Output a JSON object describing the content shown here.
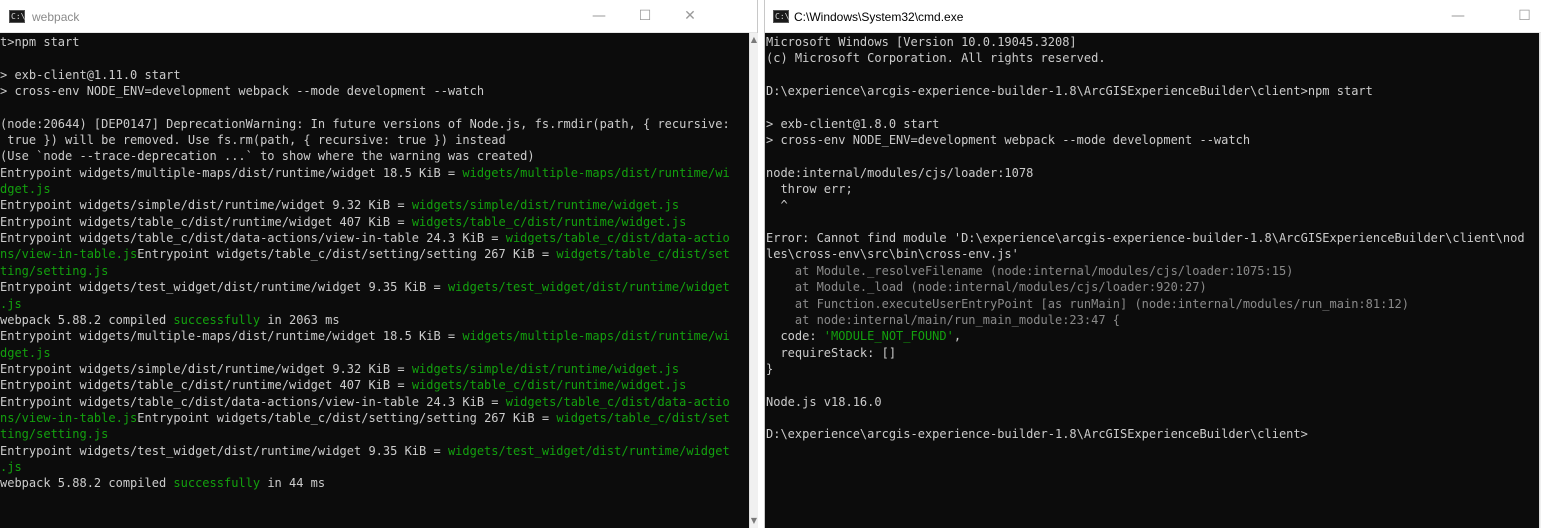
{
  "windows": [
    {
      "title": "webpack",
      "lines": [
        [
          {
            "t": "t>npm start"
          }
        ],
        [
          {
            "t": ""
          }
        ],
        [
          {
            "t": "> exb-client@1.11.0 start"
          }
        ],
        [
          {
            "t": "> cross-env NODE_ENV=development webpack --mode development --watch"
          }
        ],
        [
          {
            "t": ""
          }
        ],
        [
          {
            "t": "(node:20644) [DEP0147] DeprecationWarning: In future versions of Node.js, fs.rmdir(path, { recursive:"
          }
        ],
        [
          {
            "t": " true }) will be removed. Use fs.rm(path, { recursive: true }) instead"
          }
        ],
        [
          {
            "t": "(Use `node --trace-deprecation ...` to show where the warning was created)"
          }
        ],
        [
          {
            "t": "Entrypoint widgets/multiple-maps/dist/runtime/widget 18.5 KiB = "
          },
          {
            "t": "widgets/multiple-maps/dist/runtime/wi",
            "c": "g"
          }
        ],
        [
          {
            "t": "dget.js",
            "c": "g"
          }
        ],
        [
          {
            "t": "Entrypoint widgets/simple/dist/runtime/widget 9.32 KiB = "
          },
          {
            "t": "widgets/simple/dist/runtime/widget.js",
            "c": "g"
          }
        ],
        [
          {
            "t": "Entrypoint widgets/table_c/dist/runtime/widget 407 KiB = "
          },
          {
            "t": "widgets/table_c/dist/runtime/widget.js",
            "c": "g"
          }
        ],
        [
          {
            "t": "Entrypoint widgets/table_c/dist/data-actions/view-in-table 24.3 KiB = "
          },
          {
            "t": "widgets/table_c/dist/data-actio",
            "c": "g"
          }
        ],
        [
          {
            "t": "ns/view-in-table.js",
            "c": "g"
          },
          {
            "t": "Entrypoint widgets/table_c/dist/setting/setting 267 KiB = "
          },
          {
            "t": "widgets/table_c/dist/set",
            "c": "g"
          }
        ],
        [
          {
            "t": "ting/setting.js",
            "c": "g"
          }
        ],
        [
          {
            "t": "Entrypoint widgets/test_widget/dist/runtime/widget 9.35 KiB = "
          },
          {
            "t": "widgets/test_widget/dist/runtime/widget",
            "c": "g"
          }
        ],
        [
          {
            "t": ".js",
            "c": "g"
          }
        ],
        [
          {
            "t": "webpack 5.88.2 compiled "
          },
          {
            "t": "successfully",
            "c": "g"
          },
          {
            "t": " in 2063 ms"
          }
        ],
        [
          {
            "t": "Entrypoint widgets/multiple-maps/dist/runtime/widget 18.5 KiB = "
          },
          {
            "t": "widgets/multiple-maps/dist/runtime/wi",
            "c": "g"
          }
        ],
        [
          {
            "t": "dget.js",
            "c": "g"
          }
        ],
        [
          {
            "t": "Entrypoint widgets/simple/dist/runtime/widget 9.32 KiB = "
          },
          {
            "t": "widgets/simple/dist/runtime/widget.js",
            "c": "g"
          }
        ],
        [
          {
            "t": "Entrypoint widgets/table_c/dist/runtime/widget 407 KiB = "
          },
          {
            "t": "widgets/table_c/dist/runtime/widget.js",
            "c": "g"
          }
        ],
        [
          {
            "t": "Entrypoint widgets/table_c/dist/data-actions/view-in-table 24.3 KiB = "
          },
          {
            "t": "widgets/table_c/dist/data-actio",
            "c": "g"
          }
        ],
        [
          {
            "t": "ns/view-in-table.js",
            "c": "g"
          },
          {
            "t": "Entrypoint widgets/table_c/dist/setting/setting 267 KiB = "
          },
          {
            "t": "widgets/table_c/dist/set",
            "c": "g"
          }
        ],
        [
          {
            "t": "ting/setting.js",
            "c": "g"
          }
        ],
        [
          {
            "t": "Entrypoint widgets/test_widget/dist/runtime/widget 9.35 KiB = "
          },
          {
            "t": "widgets/test_widget/dist/runtime/widget",
            "c": "g"
          }
        ],
        [
          {
            "t": ".js",
            "c": "g"
          }
        ],
        [
          {
            "t": "webpack 5.88.2 compiled "
          },
          {
            "t": "successfully",
            "c": "g"
          },
          {
            "t": " in 44 ms"
          }
        ]
      ]
    },
    {
      "title": "C:\\Windows\\System32\\cmd.exe",
      "lines": [
        [
          {
            "t": "Microsoft Windows [Version 10.0.19045.3208]"
          }
        ],
        [
          {
            "t": "(c) Microsoft Corporation. All rights reserved."
          }
        ],
        [
          {
            "t": ""
          }
        ],
        [
          {
            "t": "D:\\experience\\arcgis-experience-builder-1.8\\ArcGISExperienceBuilder\\client>npm start"
          }
        ],
        [
          {
            "t": ""
          }
        ],
        [
          {
            "t": "> exb-client@1.8.0 start"
          }
        ],
        [
          {
            "t": "> cross-env NODE_ENV=development webpack --mode development --watch"
          }
        ],
        [
          {
            "t": ""
          }
        ],
        [
          {
            "t": "node:internal/modules/cjs/loader:1078"
          }
        ],
        [
          {
            "t": "  throw err;"
          }
        ],
        [
          {
            "t": "  ^"
          }
        ],
        [
          {
            "t": ""
          }
        ],
        [
          {
            "t": "Error: Cannot find module 'D:\\experience\\arcgis-experience-builder-1.8\\ArcGISExperienceBuilder\\client\\nod"
          }
        ],
        [
          {
            "t": "les\\cross-env\\src\\bin\\cross-env.js'"
          }
        ],
        [
          {
            "t": "    at Module._resolveFilename (node:internal/modules/cjs/loader:1075:15)",
            "c": "dim"
          }
        ],
        [
          {
            "t": "    at Module._load (node:internal/modules/cjs/loader:920:27)",
            "c": "dim"
          }
        ],
        [
          {
            "t": "    at Function.executeUserEntryPoint [as runMain] (node:internal/modules/run_main:81:12)",
            "c": "dim"
          }
        ],
        [
          {
            "t": "    at node:internal/main/run_main_module:23:47 {",
            "c": "dim"
          }
        ],
        [
          {
            "t": "  code: "
          },
          {
            "t": "'MODULE_NOT_FOUND'",
            "c": "g"
          },
          {
            "t": ","
          }
        ],
        [
          {
            "t": "  requireStack: []"
          }
        ],
        [
          {
            "t": "}"
          }
        ],
        [
          {
            "t": ""
          }
        ],
        [
          {
            "t": "Node.js v18.16.0"
          }
        ],
        [
          {
            "t": ""
          }
        ],
        [
          {
            "t": "D:\\experience\\arcgis-experience-builder-1.8\\ArcGISExperienceBuilder\\client>"
          }
        ]
      ]
    }
  ],
  "icons": {
    "minimize": "—",
    "maximize": "☐",
    "close": "✕",
    "app": "C:\\"
  },
  "colors": {
    "terminal_bg": "#0c0c0c",
    "terminal_fg": "#cccccc",
    "green": "#13a10e"
  }
}
